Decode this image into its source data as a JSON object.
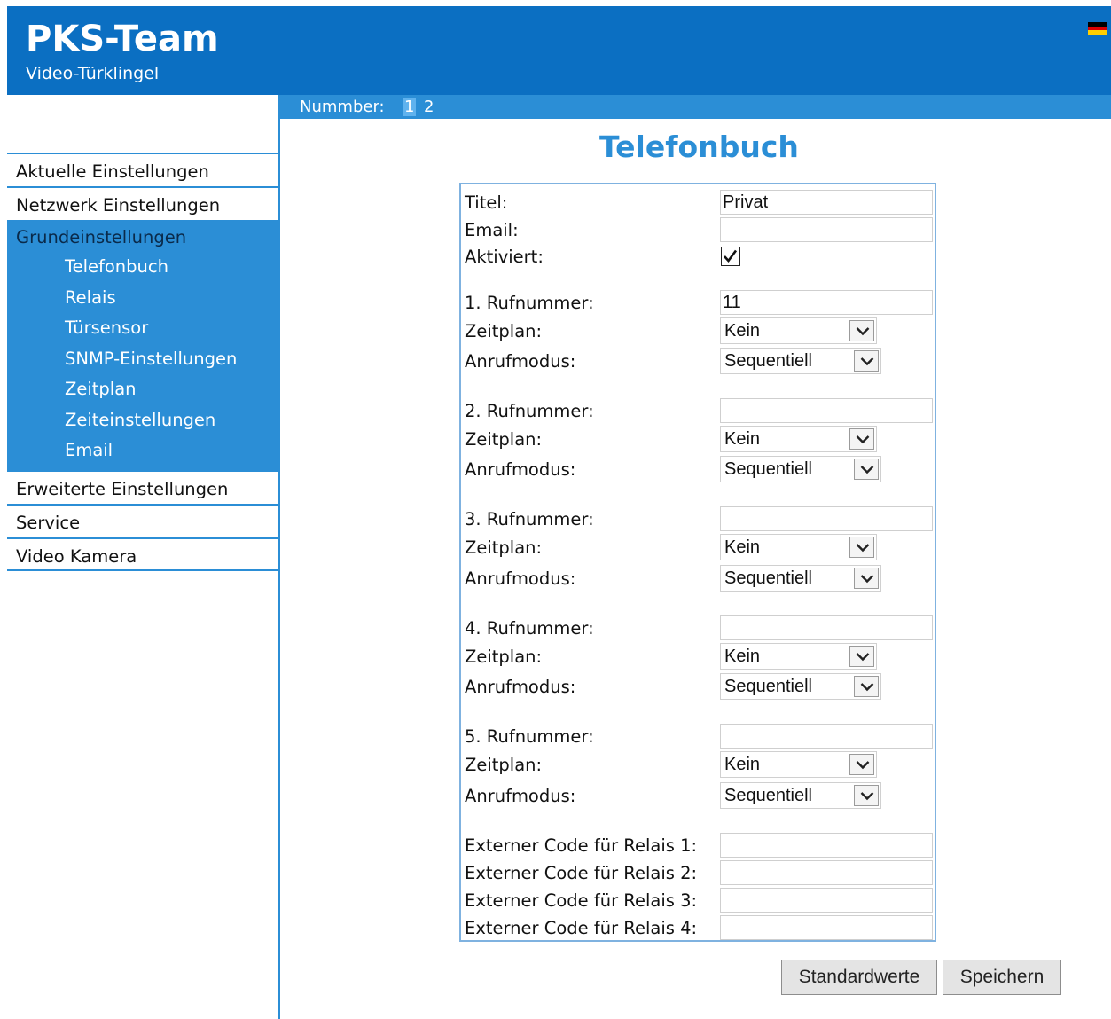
{
  "header": {
    "title": "PKS-Team",
    "subtitle": "Video-Türklingel",
    "language_icon": "german-flag-icon"
  },
  "number_bar": {
    "label": "Nummber:",
    "numbers": [
      "1",
      "2"
    ],
    "active": "1"
  },
  "sidebar": {
    "items": [
      {
        "label": "Aktuelle Einstellungen"
      },
      {
        "label": "Netzwerk Einstellungen"
      }
    ],
    "group": {
      "label": "Grundeinstellungen",
      "children": [
        "Telefonbuch",
        "Relais",
        "Türsensor",
        "SNMP-Einstellungen",
        "Zeitplan",
        "Zeiteinstellungen",
        "Email"
      ],
      "active": "Telefonbuch"
    },
    "items_after": [
      {
        "label": "Erweiterte Einstellungen"
      },
      {
        "label": "Service"
      },
      {
        "label": "Video Kamera"
      }
    ]
  },
  "main": {
    "title": "Telefonbuch",
    "titel_label": "Titel:",
    "titel_value": "Privat",
    "email_label": "Email:",
    "email_value": "",
    "aktiviert_label": "Aktiviert:",
    "aktiviert": true,
    "numbers": [
      {
        "label": "1. Rufnummer:",
        "value": "11",
        "zeitplan_label": "Zeitplan:",
        "zeitplan": "Kein",
        "anrufmodus_label": "Anrufmodus:",
        "anrufmodus": "Sequentiell"
      },
      {
        "label": "2. Rufnummer:",
        "value": "",
        "zeitplan_label": "Zeitplan:",
        "zeitplan": "Kein",
        "anrufmodus_label": "Anrufmodus:",
        "anrufmodus": "Sequentiell"
      },
      {
        "label": "3. Rufnummer:",
        "value": "",
        "zeitplan_label": "Zeitplan:",
        "zeitplan": "Kein",
        "anrufmodus_label": "Anrufmodus:",
        "anrufmodus": "Sequentiell"
      },
      {
        "label": "4. Rufnummer:",
        "value": "",
        "zeitplan_label": "Zeitplan:",
        "zeitplan": "Kein",
        "anrufmodus_label": "Anrufmodus:",
        "anrufmodus": "Sequentiell"
      },
      {
        "label": "5. Rufnummer:",
        "value": "",
        "zeitplan_label": "Zeitplan:",
        "zeitplan": "Kein",
        "anrufmodus_label": "Anrufmodus:",
        "anrufmodus": "Sequentiell"
      }
    ],
    "relay_codes": [
      {
        "label": "Externer Code für Relais 1:",
        "value": ""
      },
      {
        "label": "Externer Code für Relais 2:",
        "value": ""
      },
      {
        "label": "Externer Code für Relais 3:",
        "value": ""
      },
      {
        "label": "Externer Code für Relais 4:",
        "value": ""
      }
    ]
  },
  "buttons": {
    "defaults": "Standardwerte",
    "save": "Speichern"
  }
}
